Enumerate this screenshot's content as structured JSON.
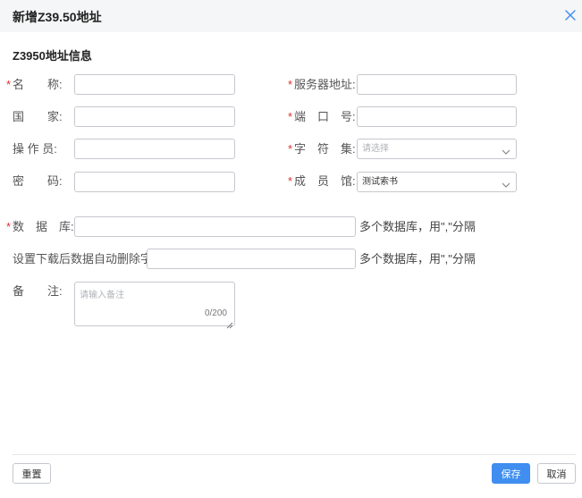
{
  "dialog": {
    "title": "新增Z39.50地址"
  },
  "section": {
    "title": "Z3950地址信息"
  },
  "form": {
    "required_mark": "*",
    "name": {
      "label": "名　　称:",
      "value": ""
    },
    "country": {
      "label": "国　　家:",
      "value": ""
    },
    "operator": {
      "label": "操 作 员:",
      "value": ""
    },
    "password": {
      "label": "密　　码:",
      "value": ""
    },
    "server": {
      "label": "服务器地址:",
      "value": ""
    },
    "port": {
      "label": "端　口　号:",
      "value": ""
    },
    "charset": {
      "label": "字　符　集:",
      "placeholder": "请选择"
    },
    "member": {
      "label": "成　员　馆:",
      "value": "测试索书"
    },
    "database": {
      "label": "数　据　库:",
      "value": "",
      "hint": "多个数据库，用\",\"分隔"
    },
    "auto_delete": {
      "label": "设置下载后数据自动删除字段:",
      "value": "",
      "hint": "多个数据库，用\",\"分隔"
    },
    "remark": {
      "label": "备　　注:",
      "placeholder": "请输入备注",
      "counter": "0/200"
    }
  },
  "footer": {
    "reset_label": "重置",
    "save_label": "保存",
    "cancel_label": "取消"
  },
  "colors": {
    "primary": "#3f8ef0",
    "required": "#e0302f",
    "header_bg": "#f5f6f7"
  }
}
